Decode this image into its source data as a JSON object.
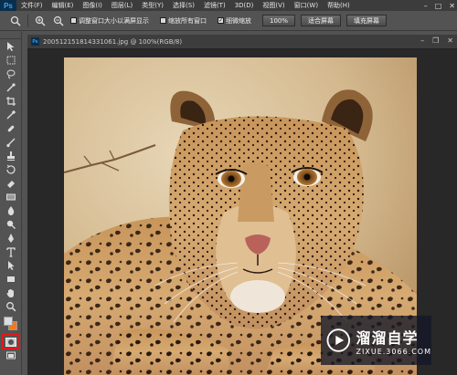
{
  "app": {
    "logo": "Ps",
    "menu": [
      "文件(F)",
      "编辑(E)",
      "图像(I)",
      "图层(L)",
      "类型(Y)",
      "选择(S)",
      "滤镜(T)",
      "3D(D)",
      "视图(V)",
      "窗口(W)",
      "帮助(H)"
    ],
    "window_controls": [
      "minimize-icon",
      "maximize-icon",
      "close-icon"
    ]
  },
  "options": {
    "tool_icon": "zoom-icon",
    "zoom_in_icon": "zoom-in-icon",
    "zoom_out_icon": "zoom-out-icon",
    "resize_windows_label": "调整窗口大小以满屏显示",
    "resize_windows_checked": false,
    "zoom_all_label": "缩放所有窗口",
    "zoom_all_checked": false,
    "scrubby_label": "细微缩放",
    "scrubby_checked": true,
    "btn_100": "100%",
    "btn_fit": "适合屏幕",
    "btn_fill": "填充屏幕"
  },
  "tools": [
    "move-tool-icon",
    "marquee-tool-icon",
    "lasso-tool-icon",
    "quick-select-icon",
    "crop-tool-icon",
    "eyedropper-icon",
    "healing-brush-icon",
    "brush-tool-icon",
    "clone-stamp-icon",
    "history-brush-icon",
    "eraser-icon",
    "gradient-icon",
    "blur-tool-icon",
    "dodge-tool-icon",
    "pen-tool-icon",
    "type-tool-icon",
    "path-select-icon",
    "shape-tool-icon",
    "hand-tool-icon",
    "zoom-tool-icon"
  ],
  "colors": {
    "foreground": "#d7dde2",
    "background": "#f07a1a",
    "highlight": "#e0191b"
  },
  "document": {
    "title": "2005121518143310​61.jpg @ 100%(RGB/8)",
    "controls": [
      "minimize-icon",
      "restore-icon",
      "close-icon"
    ],
    "image": "leopard-photo"
  },
  "watermark": {
    "title": "溜溜自学",
    "url": "ZIXUE.3066.COM"
  }
}
